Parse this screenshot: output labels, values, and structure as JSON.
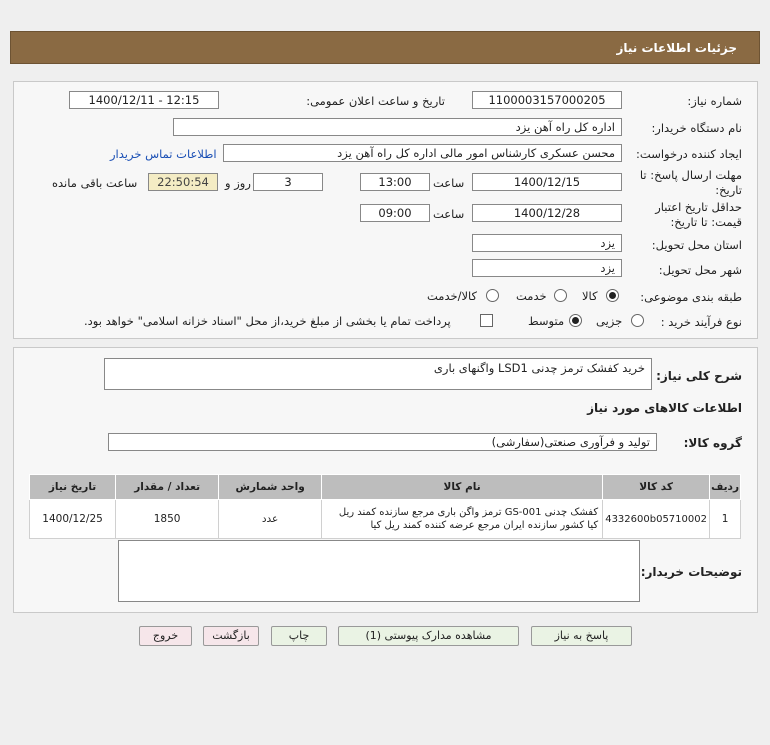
{
  "header": {
    "title": "جزئیات اطلاعات نیاز"
  },
  "form": {
    "need_number_label": "شماره نیاز:",
    "need_number": "1100003157000205",
    "announce_label": "تاریخ و ساعت اعلان عمومی:",
    "announce_value": "1400/12/11 - 12:15",
    "buyer_label": "نام دستگاه خریدار:",
    "buyer_value": "اداره کل راه آهن یزد",
    "requester_label": "ایجاد کننده درخواست:",
    "requester_value": "محسن عسکری کارشناس امور مالی اداره کل راه آهن یزد",
    "contact_link": "اطلاعات تماس خریدار",
    "deadline_label_1": "مهلت ارسال پاسخ: تا",
    "deadline_label_2": "تاریخ:",
    "deadline_date": "1400/12/15",
    "hour_label": "ساعت",
    "deadline_time": "13:00",
    "days_value": "3",
    "days_label": "روز و",
    "remaining_time": "22:50:54",
    "remaining_label": "ساعت باقی مانده",
    "validity_label_1": "حداقل تاریخ اعتبار",
    "validity_label_2": "قیمت: تا تاریخ:",
    "validity_date": "1400/12/28",
    "validity_hour_label": "ساعت",
    "validity_time": "09:00",
    "province_label": "استان محل تحویل:",
    "province_value": "یزد",
    "city_label": "شهر محل تحویل:",
    "city_value": "یزد",
    "category_label": "طبقه بندی موضوعی:",
    "category_options": [
      "کالا",
      "خدمت",
      "کالا/خدمت"
    ],
    "process_label": "نوع فرآیند خرید :",
    "process_options": [
      "جزیی",
      "متوسط"
    ],
    "payment_note": "پرداخت تمام یا بخشی از مبلغ خرید،از محل \"اسناد خزانه اسلامی\" خواهد بود."
  },
  "summary": {
    "desc_label": "شرح کلی نیاز:",
    "desc_value": "خرید کفشک ترمز چدنی LSD1 واگنهای باری",
    "goods_info_title": "اطلاعات کالاهای مورد نیاز",
    "goods_group_label": "گروه کالا:",
    "goods_group_value": "تولید و فرآوری صنعتی(سفارشی)",
    "table_headers": [
      "ردیف",
      "کد کالا",
      "نام کالا",
      "واحد شمارش",
      "تعداد / مقدار",
      "تاریخ نیاز"
    ],
    "rows": [
      {
        "index": "1",
        "code": "4332600b05710002",
        "name_line1": "کفشک چدنی GS-001 ترمز واگن باری مرجع سازنده کمند ریل",
        "name_line2": "کیا کشور سازنده ایران مرجع عرضه کننده کمند ریل کیا",
        "unit": "عدد",
        "qty": "1850",
        "date": "1400/12/25"
      }
    ],
    "buyer_notes_label": "توضیحات خریدار:",
    "buyer_notes_value": ""
  },
  "buttons": {
    "reply": "پاسخ به نیاز",
    "attachments": "مشاهده مدارک پیوستی (1)",
    "print": "چاپ",
    "back": "بازگشت",
    "exit": "خروج"
  }
}
